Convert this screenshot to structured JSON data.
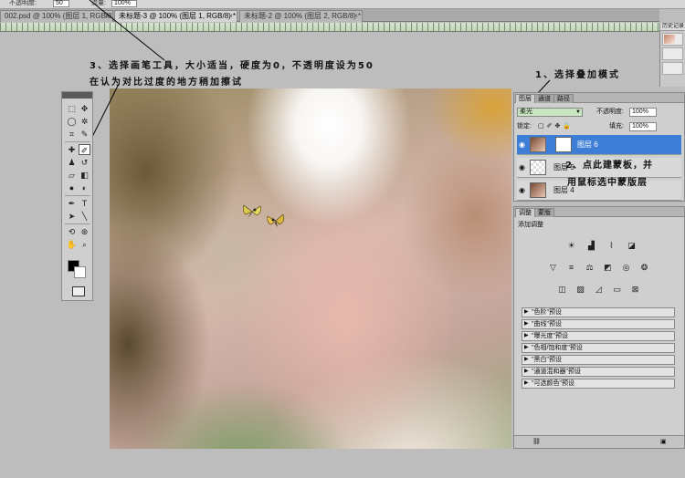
{
  "options_bar": {
    "opacity_label": "不透明度:",
    "opacity_value": "50",
    "flow_label": "流量:",
    "flow_value": "100%"
  },
  "doc_tabs": [
    {
      "label": "002.psd @ 100% (图层 1, RGB/8) *"
    },
    {
      "label": "未标题-3 @ 100% (图层 1, RGB/8) *"
    },
    {
      "label": "未标题-2 @ 100% (图层 2, RGB/8) *"
    }
  ],
  "history_panel": {
    "title": "历史记录"
  },
  "annotations": {
    "step3_line1": "3、选择画笔工具，大小适当，硬度为0，不透明度设为50",
    "step3_line2": "在认为对比过度的地方稍加擦试",
    "step1": "1、选择叠加模式",
    "step2_line1": "2、点此建蒙板，并",
    "step2_line2": "用鼠标选中蒙版层"
  },
  "toolbox": {
    "tools": [
      "marquee-tool",
      "move-tool",
      "lasso-tool",
      "magic-wand-tool",
      "crop-tool",
      "eyedropper-tool",
      "healing-brush-tool",
      "brush-tool",
      "clone-stamp-tool",
      "history-brush-tool",
      "eraser-tool",
      "gradient-tool",
      "blur-tool",
      "dodge-tool",
      "pen-tool",
      "type-tool",
      "path-selection-tool",
      "line-tool",
      "hand-tool",
      "zoom-tool",
      "3d-rotate-tool",
      "3d-orbit-tool"
    ],
    "selected": "brush-tool",
    "foreground_color": "#000000",
    "background_color": "#ffffff"
  },
  "layers_panel": {
    "tabs": [
      "图层",
      "通道",
      "路径"
    ],
    "blend_mode": "柔光",
    "opacity_label": "不透明度:",
    "opacity_value": "100%",
    "lock_label": "锁定:",
    "fill_label": "填充:",
    "fill_value": "100%",
    "layers": [
      {
        "name": "图层 6",
        "selected": true
      },
      {
        "name": "图层 5",
        "selected": false
      },
      {
        "name": "图层 4",
        "selected": false
      }
    ]
  },
  "adjust_panel": {
    "tabs": [
      "调整",
      "蒙版"
    ],
    "title": "添加调整",
    "presets": [
      "\"色阶\"预设",
      "\"曲线\"预设",
      "\"曝光度\"预设",
      "\"色相/饱和度\"预设",
      "\"黑白\"预设",
      "\"通道混和器\"预设",
      "\"可选颜色\"预设"
    ]
  },
  "colors": {
    "selection_blue": "#3d7fd6",
    "blend_green": "#c8e6c0"
  }
}
